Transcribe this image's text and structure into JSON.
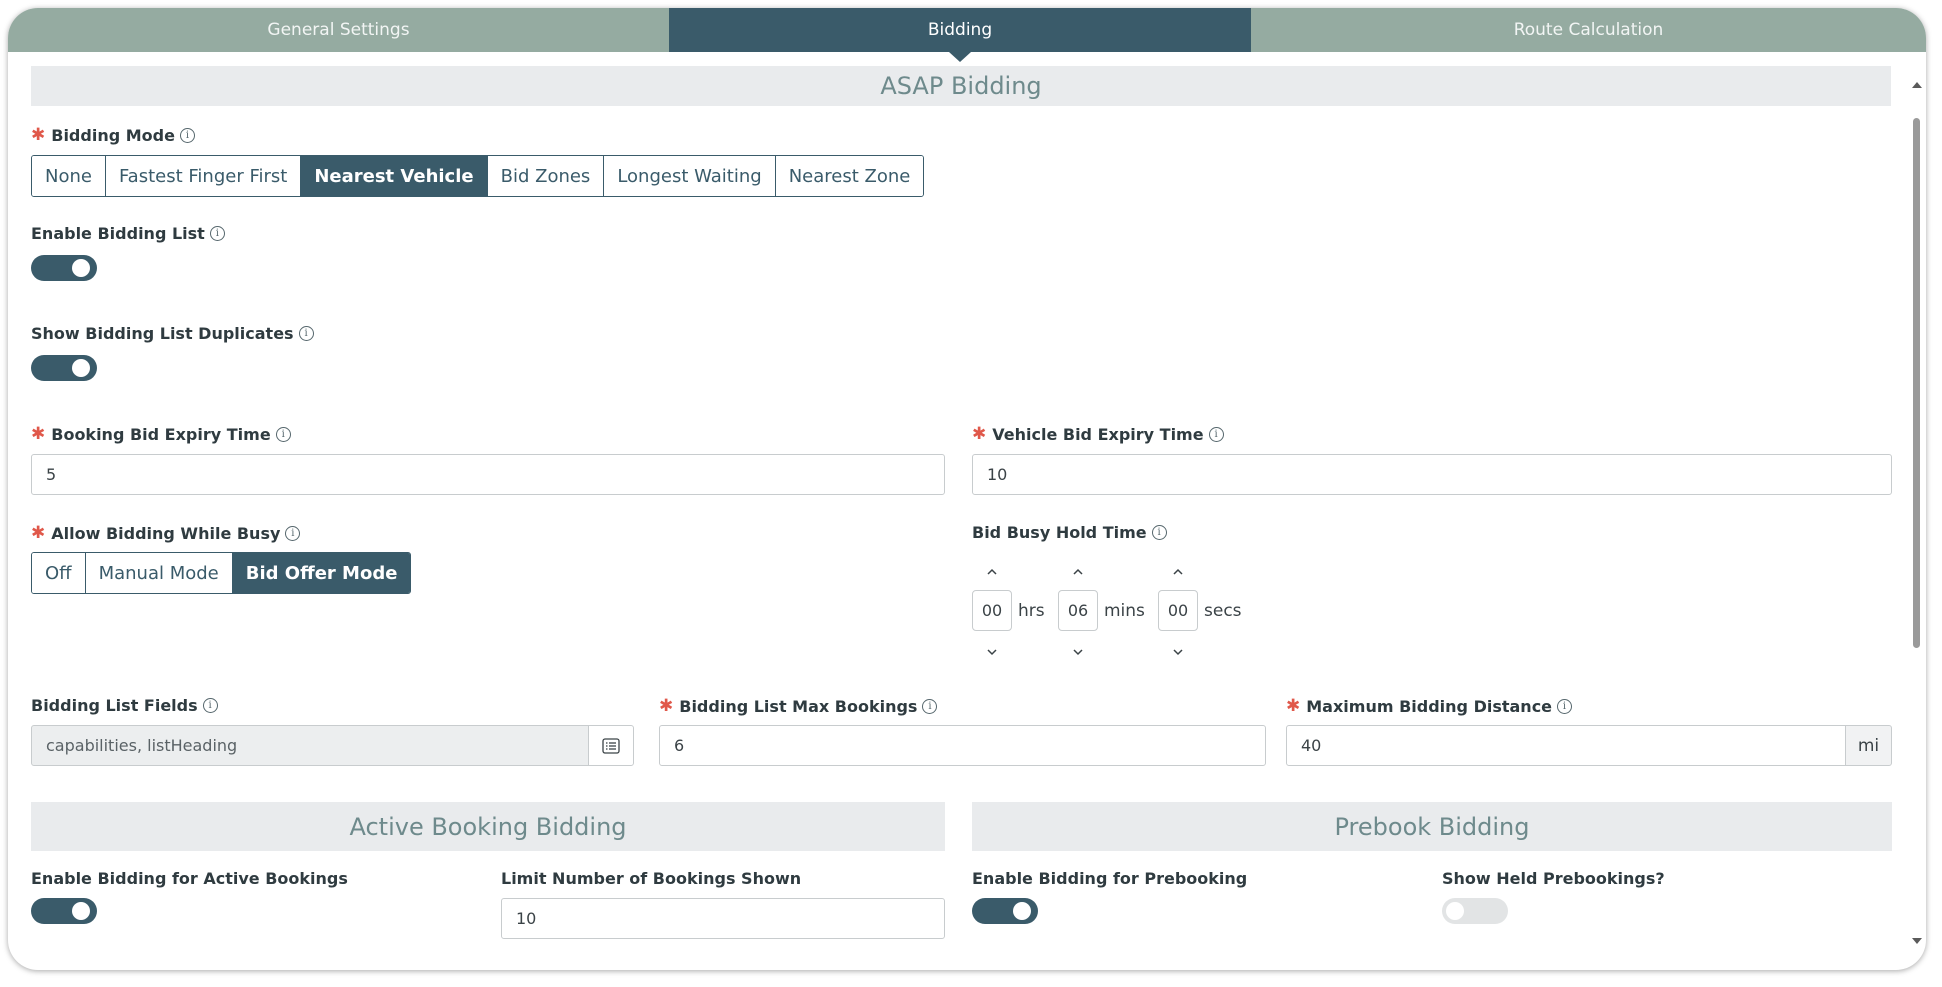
{
  "tabs": [
    {
      "label": "General Settings",
      "active": false
    },
    {
      "label": "Bidding",
      "active": true
    },
    {
      "label": "Route Calculation",
      "active": false
    }
  ],
  "asap": {
    "header": "ASAP Bidding",
    "bidding_mode": {
      "label": "Bidding Mode",
      "required": true,
      "options": [
        "None",
        "Fastest Finger First",
        "Nearest Vehicle",
        "Bid Zones",
        "Longest Waiting",
        "Nearest Zone"
      ],
      "selected": "Nearest Vehicle"
    },
    "enable_bidding_list": {
      "label": "Enable Bidding List",
      "on": true
    },
    "show_duplicates": {
      "label": "Show Bidding List Duplicates",
      "on": true
    },
    "booking_bid_expiry": {
      "label": "Booking Bid Expiry Time",
      "value": "5",
      "required": true
    },
    "vehicle_bid_expiry": {
      "label": "Vehicle Bid Expiry Time",
      "value": "10",
      "required": true
    },
    "allow_while_busy": {
      "label": "Allow Bidding While Busy",
      "required": true,
      "options": [
        "Off",
        "Manual Mode",
        "Bid Offer Mode"
      ],
      "selected": "Bid Offer Mode"
    },
    "bid_busy_hold": {
      "label": "Bid Busy Hold Time",
      "hours": "00",
      "hours_unit": "hrs",
      "minutes": "06",
      "minutes_unit": "mins",
      "seconds": "00",
      "seconds_unit": "secs"
    },
    "bidding_list_fields": {
      "label": "Bidding List Fields",
      "value": "capabilities, listHeading",
      "icon": "list-icon"
    },
    "max_bookings": {
      "label": "Bidding List Max Bookings",
      "value": "6",
      "required": true
    },
    "max_distance": {
      "label": "Maximum Bidding Distance",
      "value": "40",
      "unit": "mi",
      "required": true
    }
  },
  "active": {
    "header": "Active Booking Bidding",
    "enable": {
      "label": "Enable Bidding for Active Bookings",
      "on": true
    },
    "limit": {
      "label": "Limit Number of Bookings Shown",
      "value": "10"
    }
  },
  "prebook": {
    "header": "Prebook Bidding",
    "enable": {
      "label": "Enable Bidding for Prebooking",
      "on": true
    },
    "show_held": {
      "label": "Show Held Prebookings?",
      "on": false
    }
  },
  "colors": {
    "accent": "#3a5b6a",
    "tab_bg": "#95aba1",
    "required": "#e0584a",
    "section_bg": "#e9ebed"
  }
}
